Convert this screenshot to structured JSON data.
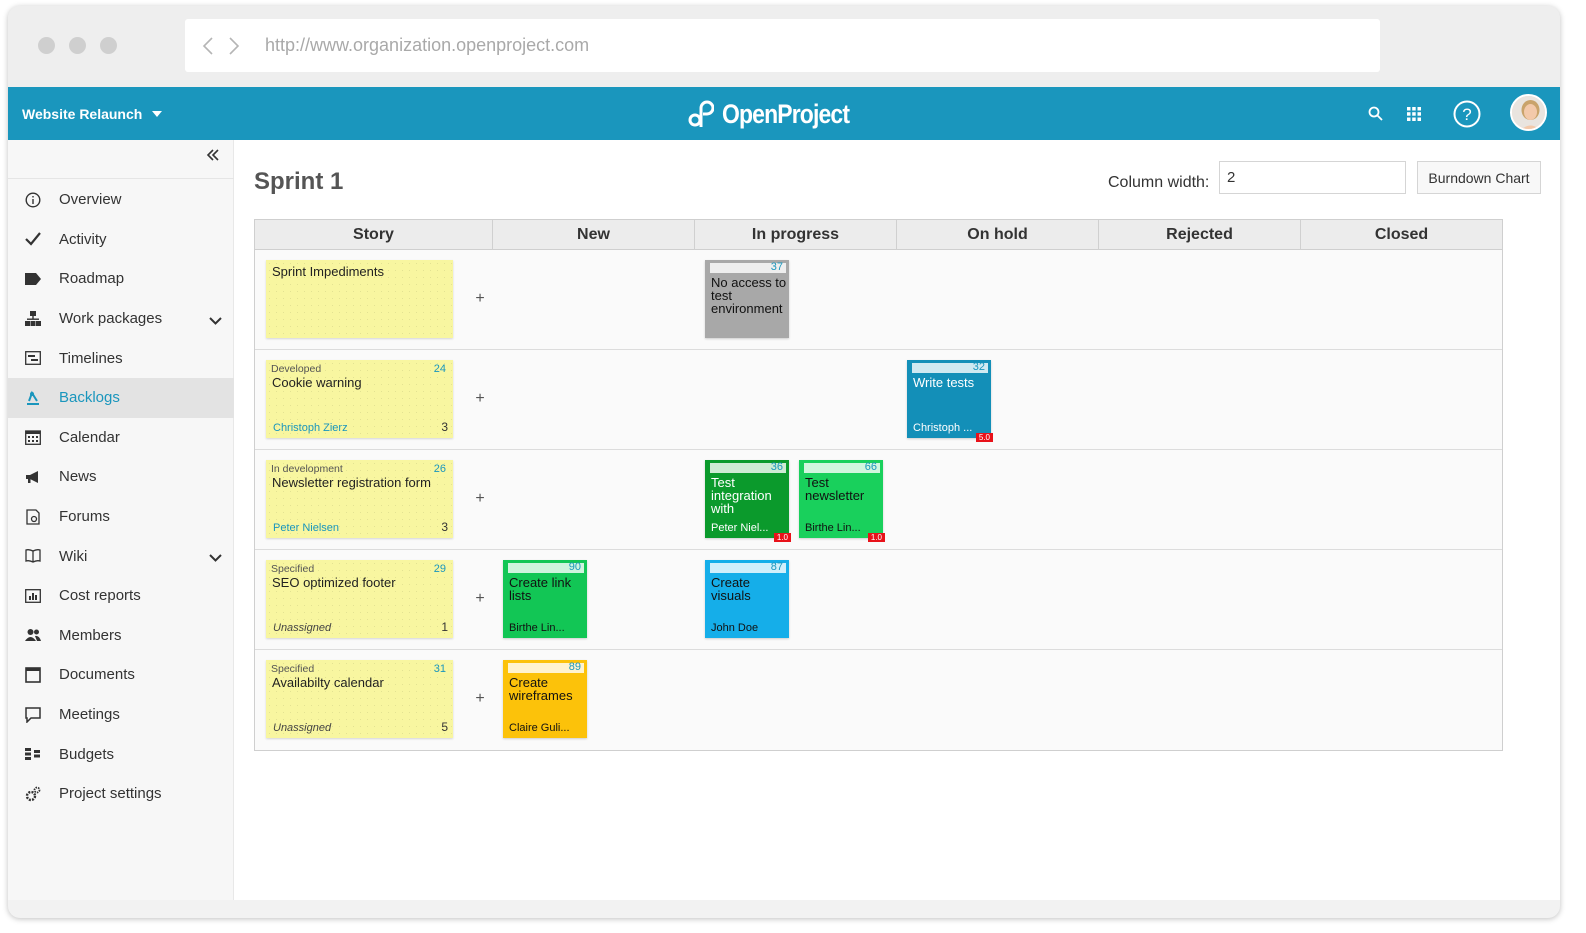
{
  "browser": {
    "url": "http://www.organization.openproject.com"
  },
  "header": {
    "project_name": "Website Relaunch",
    "logo_text": "OpenProject"
  },
  "sidebar": {
    "items": [
      {
        "label": "Overview",
        "icon": "info-icon"
      },
      {
        "label": "Activity",
        "icon": "check-icon"
      },
      {
        "label": "Roadmap",
        "icon": "tag-icon"
      },
      {
        "label": "Work packages",
        "icon": "hierarchy-icon",
        "expandable": true
      },
      {
        "label": "Timelines",
        "icon": "timeline-icon"
      },
      {
        "label": "Backlogs",
        "icon": "backlogs-icon",
        "active": true
      },
      {
        "label": "Calendar",
        "icon": "calendar-icon"
      },
      {
        "label": "News",
        "icon": "megaphone-icon"
      },
      {
        "label": "Forums",
        "icon": "forum-icon"
      },
      {
        "label": "Wiki",
        "icon": "book-icon",
        "expandable": true
      },
      {
        "label": "Cost reports",
        "icon": "cost-report-icon"
      },
      {
        "label": "Members",
        "icon": "members-icon"
      },
      {
        "label": "Documents",
        "icon": "document-icon"
      },
      {
        "label": "Meetings",
        "icon": "meeting-icon"
      },
      {
        "label": "Budgets",
        "icon": "budget-icon"
      },
      {
        "label": "Project settings",
        "icon": "settings-icon"
      }
    ]
  },
  "page": {
    "title": "Sprint 1",
    "column_width_label": "Column width:",
    "column_width_value": "2",
    "burndown_label": "Burndown Chart"
  },
  "board": {
    "columns": [
      "Story",
      "New",
      "In progress",
      "On hold",
      "Rejected",
      "Closed"
    ],
    "plus": "+",
    "rows": [
      {
        "story": {
          "status": "",
          "id": "",
          "title": "Sprint Impediments",
          "assignee": "",
          "points": ""
        },
        "tasks": [
          {
            "column": "In progress",
            "slot": 0,
            "id": "37",
            "title": "No access to test environment",
            "assignee": "",
            "hours": "",
            "color": "#a8a8a8"
          }
        ]
      },
      {
        "story": {
          "status": "Developed",
          "id": "24",
          "title": "Cookie warning",
          "assignee": "Christoph Zierz",
          "points": "3"
        },
        "tasks": [
          {
            "column": "On hold",
            "slot": 0,
            "id": "32",
            "title": "Write tests",
            "assignee": "Christoph ...",
            "hours": "5.0",
            "color": "#138fb8",
            "light": true
          }
        ]
      },
      {
        "story": {
          "status": "In development",
          "id": "26",
          "title": "Newsletter registration form",
          "assignee": "Peter Nielsen",
          "points": "3"
        },
        "tasks": [
          {
            "column": "In progress",
            "slot": 0,
            "id": "36",
            "title": "Test integration with",
            "assignee": "Peter Niel...",
            "hours": "1.0",
            "color": "#0b9a2c",
            "light": true
          },
          {
            "column": "In progress",
            "slot": 1,
            "id": "66",
            "title": "Test newsletter",
            "assignee": "Birthe Lin...",
            "hours": "1.0",
            "color": "#19d05c"
          }
        ]
      },
      {
        "story": {
          "status": "Specified",
          "id": "29",
          "title": "SEO optimized footer",
          "assignee": "Unassigned",
          "points": "1"
        },
        "tasks": [
          {
            "column": "New",
            "slot": 0,
            "id": "90",
            "title": "Create link lists",
            "assignee": "Birthe Lin...",
            "hours": "",
            "color": "#12c655"
          },
          {
            "column": "In progress",
            "slot": 0,
            "id": "87",
            "title": "Create visuals",
            "assignee": "John Doe",
            "hours": "",
            "color": "#15aee9"
          }
        ]
      },
      {
        "story": {
          "status": "Specified",
          "id": "31",
          "title": "Availabilty calendar",
          "assignee": "Unassigned",
          "points": "5"
        },
        "tasks": [
          {
            "column": "New",
            "slot": 0,
            "id": "89",
            "title": "Create wireframes",
            "assignee": "Claire Guli...",
            "hours": "",
            "color": "#fcc20a"
          }
        ]
      }
    ]
  },
  "colors": {
    "brand": "#1a96bd",
    "story_card": "#f8f6a0",
    "hours_badge": "#e8121a"
  }
}
